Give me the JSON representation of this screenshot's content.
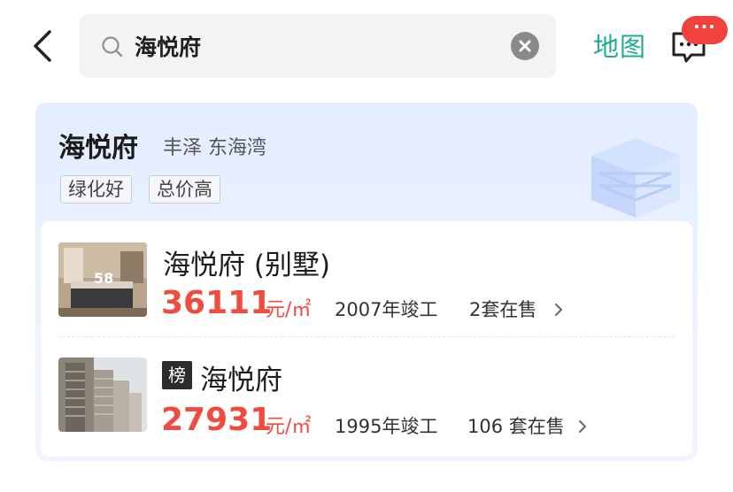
{
  "search": {
    "query": "海悦府"
  },
  "header": {
    "map_label": "地图",
    "badge_text": "···"
  },
  "community": {
    "name": "海悦府",
    "area": "丰泽 东海湾",
    "tags": [
      "绿化好",
      "总价高"
    ]
  },
  "listings": [
    {
      "title": "海悦府 (别墅)",
      "price": "36111",
      "unit": "元/㎡",
      "built": "2007年竣工",
      "on_sale": "2套在售",
      "thumb_text": "58"
    },
    {
      "rank_label": "榜",
      "title": "海悦府",
      "price": "27931",
      "unit": "元/㎡",
      "built": "1995年竣工",
      "on_sale": "106 套在售"
    }
  ],
  "colors": {
    "accent_green": "#1fae8b",
    "price_red": "#f04b3f",
    "badge_red": "#f0433e"
  }
}
